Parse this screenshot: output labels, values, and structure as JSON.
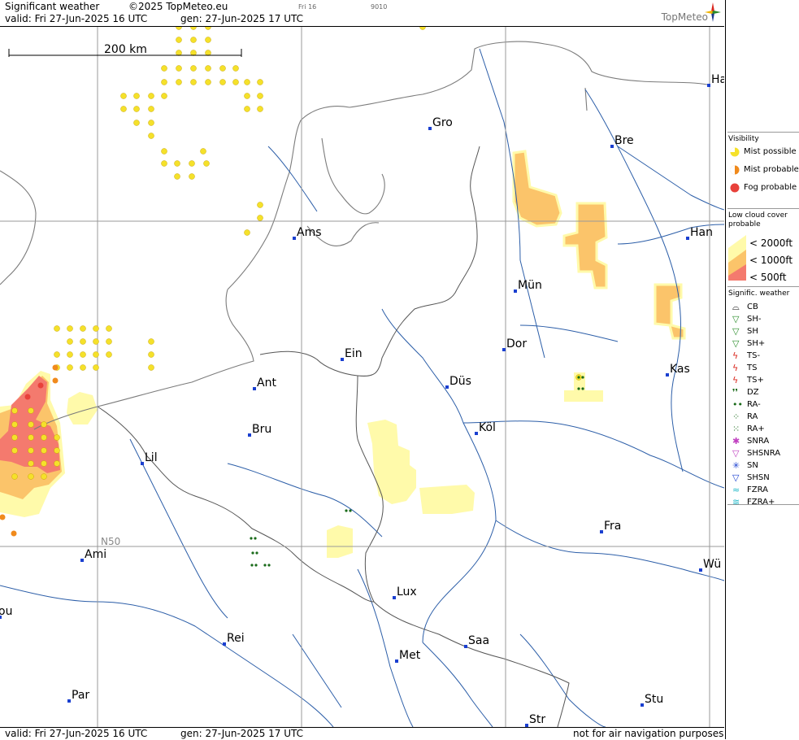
{
  "header": {
    "product": "Significant weather",
    "copyright": "©2025 TopMeteo.eu",
    "frame_label": "Fri 16",
    "code": "9010",
    "valid": "valid:  Fri  27-Jun-2025  16 UTC",
    "generated": "gen:  27-Jun-2025 17 UTC",
    "brand": "TopMeteo"
  },
  "scale": {
    "label": "200 km"
  },
  "grid": {
    "lat_label": "N50"
  },
  "cities": [
    {
      "label": "Gro"
    },
    {
      "label": "Bre"
    },
    {
      "label": "Ha"
    },
    {
      "label": "Ams"
    },
    {
      "label": "Han"
    },
    {
      "label": "Mün"
    },
    {
      "label": "Dor"
    },
    {
      "label": "Ein"
    },
    {
      "label": "Ant"
    },
    {
      "label": "Düs"
    },
    {
      "label": "Kas"
    },
    {
      "label": "Bru"
    },
    {
      "label": "Köl"
    },
    {
      "label": "Lil"
    },
    {
      "label": "Ami"
    },
    {
      "label": "Fra"
    },
    {
      "label": "Wü"
    },
    {
      "label": "Lux"
    },
    {
      "label": "ou"
    },
    {
      "label": "Rei"
    },
    {
      "label": "Saa"
    },
    {
      "label": "Met"
    },
    {
      "label": "Par"
    },
    {
      "label": "Stu"
    },
    {
      "label": "Str"
    }
  ],
  "footer": {
    "valid": "valid:  Fri  27-Jun-2025  16 UTC",
    "generated": "gen:  27-Jun-2025 17 UTC",
    "disclaimer": "not for air navigation purposes"
  },
  "legend": {
    "visibility_title": "Visibility",
    "visibility": [
      {
        "label": "Mist possible",
        "color": "#f5e12a"
      },
      {
        "label": "Mist probable",
        "color": "#f08a1c"
      },
      {
        "label": "Fog probable",
        "color": "#e8413a"
      }
    ],
    "cloud_title": "Low cloud cover probable",
    "cloud": [
      {
        "label": "< 2000ft",
        "color": "#fffaaa"
      },
      {
        "label": "< 1000ft",
        "color": "#fbc46a"
      },
      {
        "label": "<   500ft",
        "color": "#f47a6e"
      }
    ],
    "weather_title": "Signific. weather",
    "weather": [
      {
        "label": "CB",
        "icon": "cb-icon"
      },
      {
        "label": "SH-",
        "icon": "shower-light-icon"
      },
      {
        "label": "SH",
        "icon": "shower-icon"
      },
      {
        "label": "SH+",
        "icon": "shower-heavy-icon"
      },
      {
        "label": "TS-",
        "icon": "thunder-light-icon"
      },
      {
        "label": "TS",
        "icon": "thunder-icon"
      },
      {
        "label": "TS+",
        "icon": "thunder-heavy-icon"
      },
      {
        "label": "DZ",
        "icon": "drizzle-icon"
      },
      {
        "label": "RA-",
        "icon": "rain-light-icon"
      },
      {
        "label": "RA",
        "icon": "rain-icon"
      },
      {
        "label": "RA+",
        "icon": "rain-heavy-icon"
      },
      {
        "label": "SNRA",
        "icon": "sleet-icon"
      },
      {
        "label": "SHSNRA",
        "icon": "sleet-shower-icon"
      },
      {
        "label": "SN",
        "icon": "snow-icon"
      },
      {
        "label": "SHSN",
        "icon": "snow-shower-icon"
      },
      {
        "label": "FZRA",
        "icon": "freezing-rain-icon"
      },
      {
        "label": "FZRA+",
        "icon": "freezing-rain-heavy-icon"
      }
    ]
  }
}
